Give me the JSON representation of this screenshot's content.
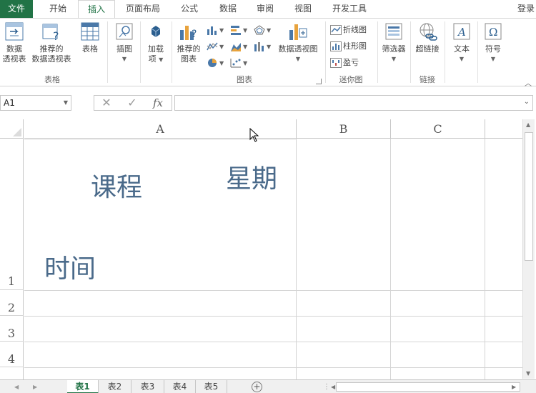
{
  "ribbon_tabs": [
    "文件",
    "开始",
    "插入",
    "页面布局",
    "公式",
    "数据",
    "审阅",
    "视图",
    "开发工具"
  ],
  "login": "登录",
  "groups": {
    "tables": {
      "label": "表格",
      "pivot": [
        "数据",
        "透视表"
      ],
      "recommended_pivot": [
        "推荐的",
        "数据透视表"
      ],
      "table": "表格"
    },
    "illustrations": {
      "label": "插图"
    },
    "addins": {
      "label": [
        "加载",
        "项"
      ]
    },
    "charts": {
      "label": "图表",
      "recommended": [
        "推荐的",
        "图表"
      ],
      "pivot_chart": "数据透视图"
    },
    "sparklines": {
      "label": "迷你图",
      "line": "折线图",
      "column": "柱形图",
      "winloss": "盈亏"
    },
    "filters": {
      "label": "筛选器"
    },
    "links": {
      "label": "链接",
      "hyperlink": "超链接"
    },
    "text": {
      "label": "文本"
    },
    "symbols": {
      "label": "符号"
    }
  },
  "formula_bar": {
    "name_box": "A1",
    "formula": ""
  },
  "columns": [
    "A",
    "B",
    "C"
  ],
  "rows": [
    "1",
    "2",
    "3",
    "4"
  ],
  "cell_a1": {
    "course": "课程",
    "weekday": "星期",
    "time": "时间"
  },
  "sheets": [
    "表1",
    "表2",
    "表3",
    "表4",
    "表5"
  ],
  "active_sheet": "表1",
  "colors": {
    "accent": "#217346",
    "cell_text": "#4a6a8a"
  }
}
